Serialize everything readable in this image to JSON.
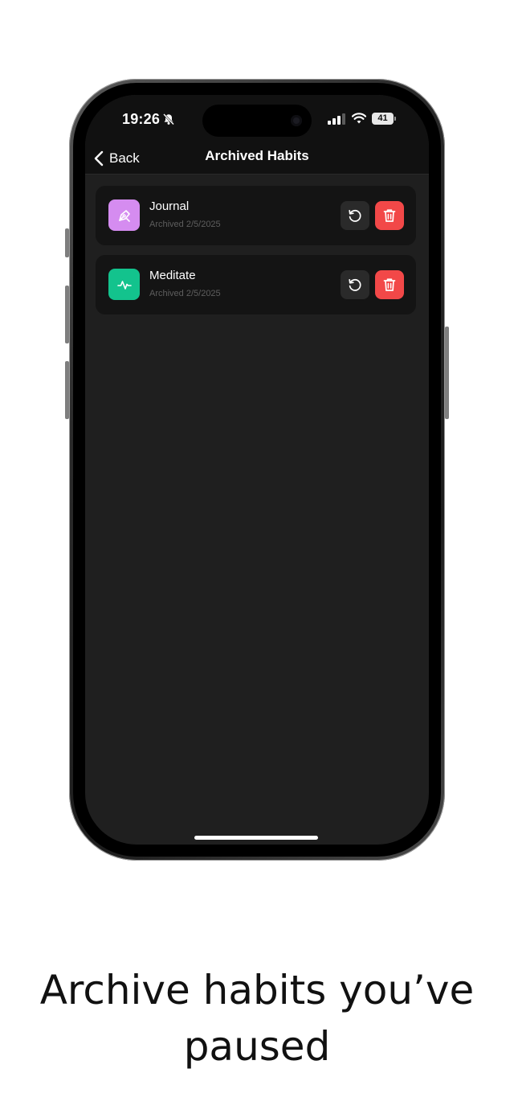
{
  "status_bar": {
    "time": "19:26",
    "battery": "41",
    "icons": [
      "bell-slash-icon",
      "signal-icon",
      "wifi-icon",
      "battery-icon"
    ]
  },
  "nav": {
    "back_label": "Back",
    "title": "Archived Habits",
    "back_icon": "chevron-left-icon"
  },
  "habits": [
    {
      "name": "Journal",
      "archived_text": "Archived 2/5/2025",
      "icon": "pen-nib-icon",
      "icon_color": "#d58cf0"
    },
    {
      "name": "Meditate",
      "archived_text": "Archived 2/5/2025",
      "icon": "activity-icon",
      "icon_color": "#13c38d"
    }
  ],
  "actions": {
    "restore_icon": "restore-icon",
    "delete_icon": "trash-icon",
    "delete_color": "#f24848"
  },
  "caption": {
    "line1": "Archive habits you’ve",
    "line2": "paused"
  }
}
